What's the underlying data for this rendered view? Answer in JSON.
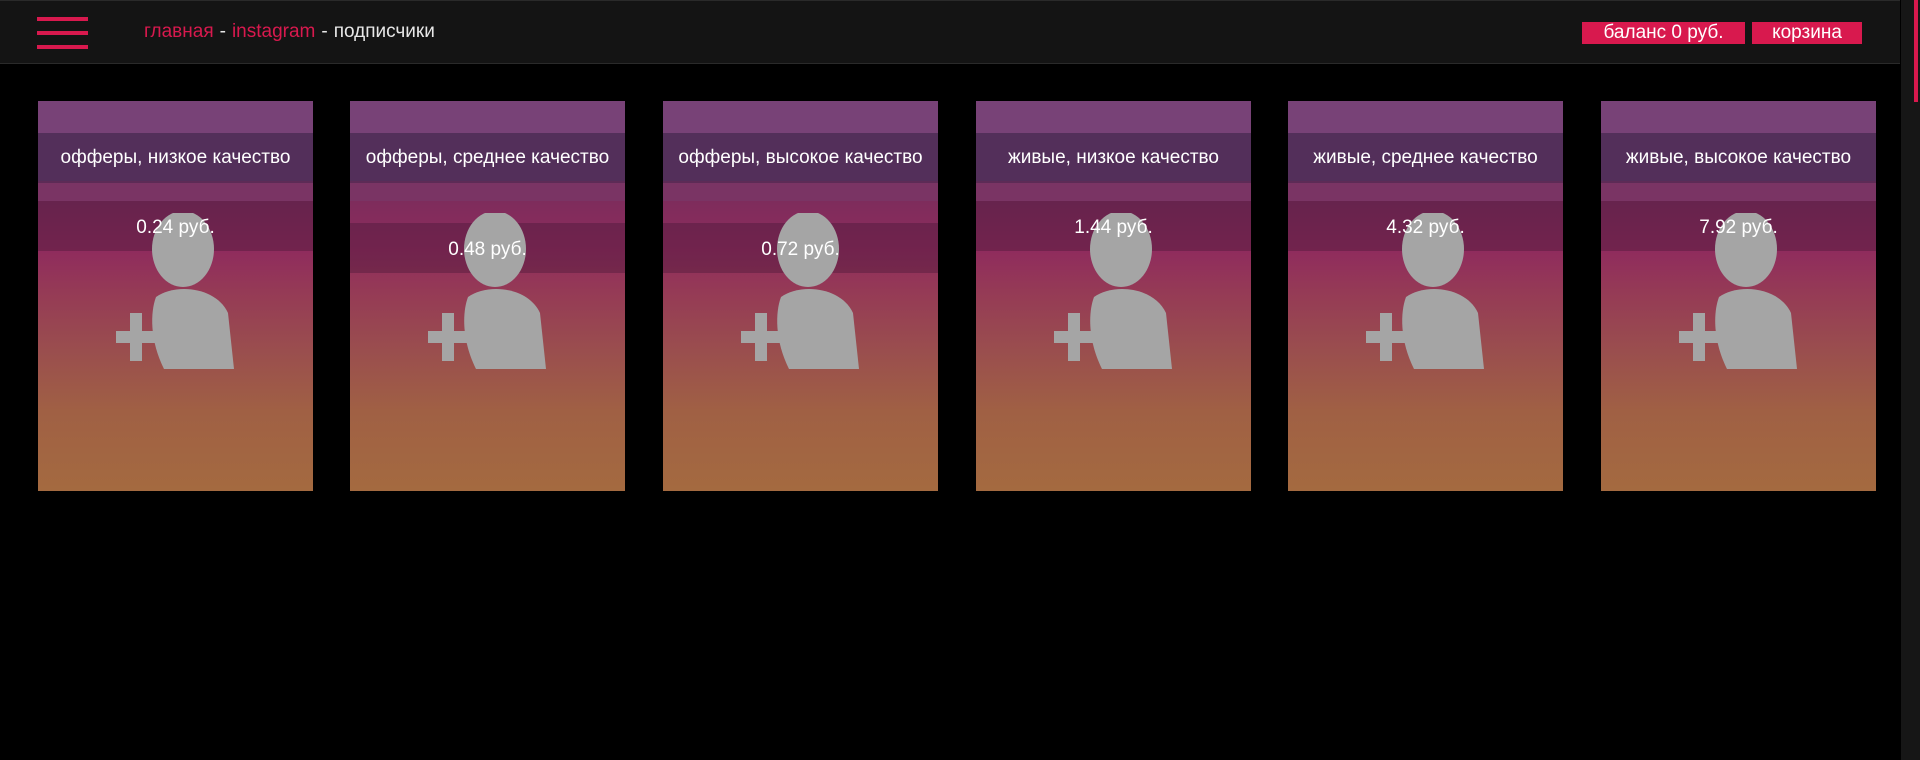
{
  "header": {
    "breadcrumb": {
      "home": "главная",
      "section": "instagram",
      "current": "подписчики",
      "separator": "-"
    },
    "balance_label": "баланс 0 руб.",
    "cart_label": "корзина"
  },
  "colors": {
    "accent": "#d8194e",
    "topbar_bg": "#141414",
    "page_bg": "#000000"
  },
  "cards": [
    {
      "title": "офферы, низкое качество",
      "price": "0.24 руб.",
      "icon": "add-user-icon"
    },
    {
      "title": "офферы, среднее качество",
      "price": "0.48 руб.",
      "icon": "add-user-icon"
    },
    {
      "title": "офферы, высокое качество",
      "price": "0.72 руб.",
      "icon": "add-user-icon"
    },
    {
      "title": "живые, низкое качество",
      "price": "1.44 руб.",
      "icon": "add-user-icon"
    },
    {
      "title": "живые, среднее качество",
      "price": "4.32 руб.",
      "icon": "add-user-icon"
    },
    {
      "title": "живые, высокое качество",
      "price": "7.92 руб.",
      "icon": "add-user-icon"
    }
  ]
}
